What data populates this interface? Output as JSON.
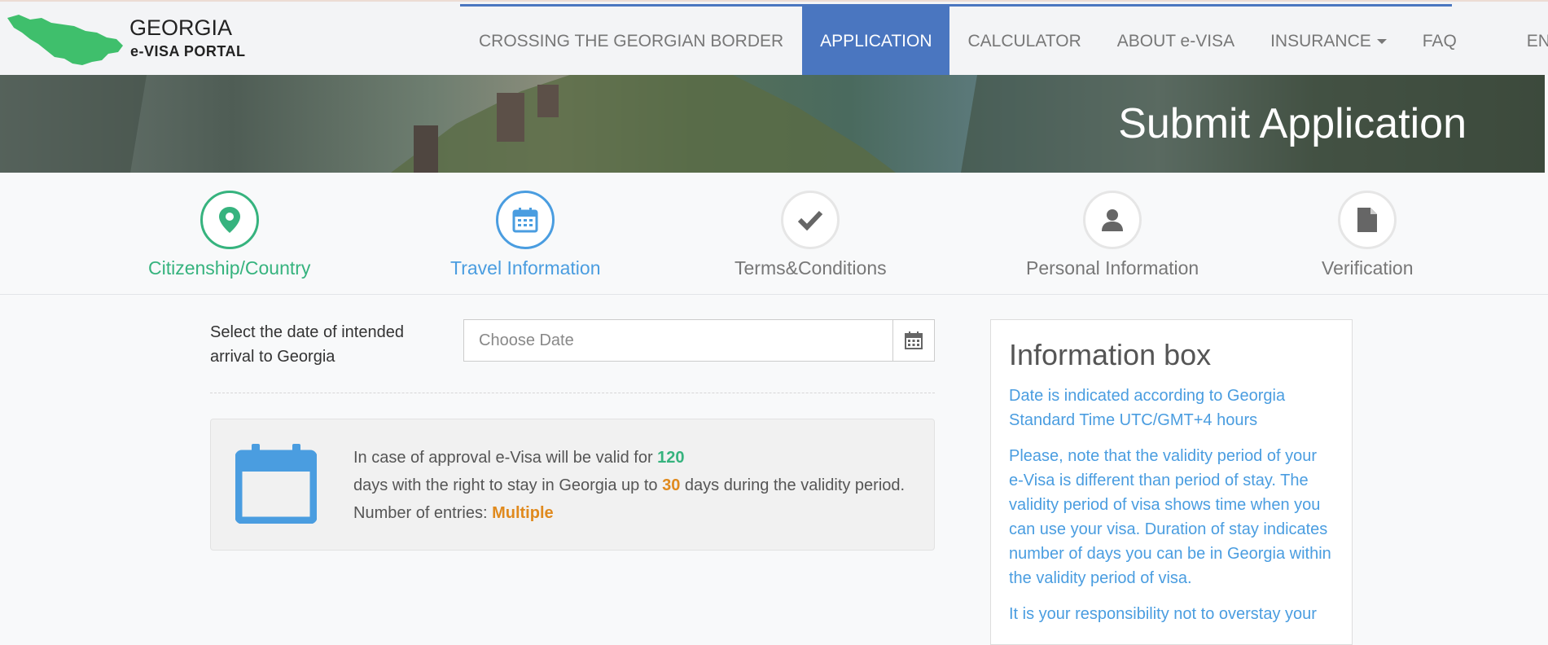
{
  "header": {
    "brand_line1": "GEORGIA",
    "brand_line2": "e-VISA PORTAL",
    "nav": [
      {
        "label": "CROSSING THE GEORGIAN BORDER",
        "active": false
      },
      {
        "label": "APPLICATION",
        "active": true
      },
      {
        "label": "CALCULATOR",
        "active": false
      },
      {
        "label": "ABOUT e-VISA",
        "active": false
      },
      {
        "label": "INSURANCE",
        "active": false,
        "dropdown": true
      },
      {
        "label": "FAQ",
        "active": false
      },
      {
        "label": "EN",
        "active": false,
        "dropdown": true
      }
    ]
  },
  "banner": {
    "title": "Submit Application"
  },
  "steps": [
    {
      "label": "Citizenship/Country",
      "state": "done",
      "icon": "map-marker-icon"
    },
    {
      "label": "Travel Information",
      "state": "current",
      "icon": "calendar-icon"
    },
    {
      "label": "Terms&Conditions",
      "state": "pending",
      "icon": "checkmark-icon"
    },
    {
      "label": "Personal Information",
      "state": "pending",
      "icon": "user-icon"
    },
    {
      "label": "Verification",
      "state": "pending",
      "icon": "document-icon"
    }
  ],
  "form": {
    "arrival_label": "Select the date of intended arrival to Georgia",
    "date_placeholder": "Choose Date"
  },
  "validity": {
    "text1": "In case of approval e-Visa will be valid for",
    "valid_days": "120",
    "text2": "days with the right to stay in Georgia up to",
    "stay_days": "30",
    "text3": "days during the validity period.",
    "entries_label": "Number of entries:",
    "entries_value": "Multiple"
  },
  "info_box": {
    "title": "Information box",
    "p1": "Date is indicated according to Georgia Standard Time UTC/GMT+4 hours",
    "p2": "Please, note that the validity period of your e-Visa is different than period of stay. The validity period of visa shows time when you can use your visa. Duration of stay indicates number of days you can be in Georgia within the validity period of visa.",
    "p3": "It is your responsibility not to overstay your"
  },
  "colors": {
    "accent": "#4a76c0",
    "done_green": "#36b37e",
    "current_blue": "#4a9de0",
    "orange": "#e08a1e"
  }
}
